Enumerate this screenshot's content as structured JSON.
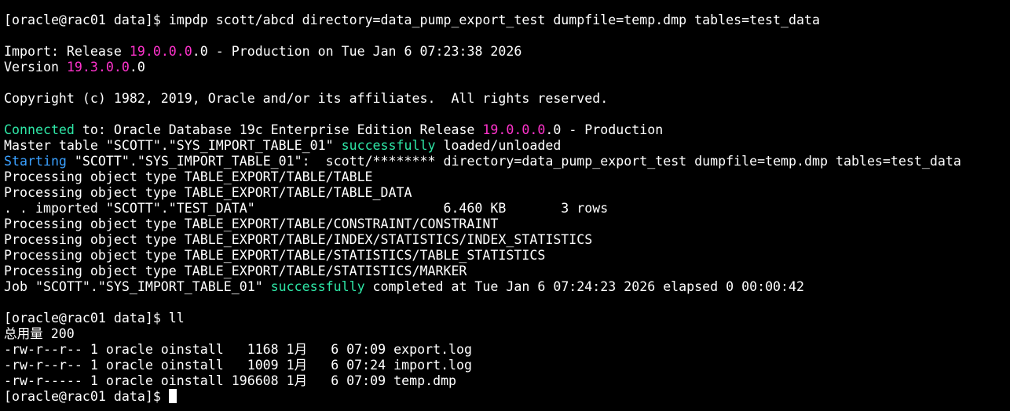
{
  "colors": {
    "background": "#000000",
    "foreground": "#ffffff",
    "magenta": "#ff33cc",
    "green": "#2ee6a6",
    "blue": "#3aa0ff",
    "cursor": "#ffffff"
  },
  "terminal": {
    "lines": [
      {
        "segments": [
          {
            "text": "[oracle@rac01 data]$ impdp scott/abcd directory=data_pump_export_test dumpfile=temp.dmp tables=test_data"
          }
        ]
      },
      {
        "segments": [
          {
            "text": ""
          }
        ]
      },
      {
        "segments": [
          {
            "text": "Import: Release "
          },
          {
            "text": "19.0.0.0",
            "color": "magenta"
          },
          {
            "text": ".0 - Production on Tue Jan 6 07:23:38 2026"
          }
        ]
      },
      {
        "segments": [
          {
            "text": "Version "
          },
          {
            "text": "19.3.0.0",
            "color": "magenta"
          },
          {
            "text": ".0"
          }
        ]
      },
      {
        "segments": [
          {
            "text": ""
          }
        ]
      },
      {
        "segments": [
          {
            "text": "Copyright (c) 1982, 2019, Oracle and/or its affiliates.  All rights reserved."
          }
        ]
      },
      {
        "segments": [
          {
            "text": ""
          }
        ]
      },
      {
        "segments": [
          {
            "text": "Connected",
            "color": "green"
          },
          {
            "text": " to: Oracle Database 19c Enterprise Edition Release "
          },
          {
            "text": "19.0.0.0",
            "color": "magenta"
          },
          {
            "text": ".0 - Production"
          }
        ]
      },
      {
        "segments": [
          {
            "text": "Master table \"SCOTT\".\"SYS_IMPORT_TABLE_01\" "
          },
          {
            "text": "successfully",
            "color": "green"
          },
          {
            "text": " loaded/unloaded"
          }
        ]
      },
      {
        "segments": [
          {
            "text": "Starting",
            "color": "blue"
          },
          {
            "text": " \"SCOTT\".\"SYS_IMPORT_TABLE_01\":  scott/******** directory=data_pump_export_test dumpfile=temp.dmp tables=test_data"
          }
        ]
      },
      {
        "segments": [
          {
            "text": "Processing object type TABLE_EXPORT/TABLE/TABLE"
          }
        ]
      },
      {
        "segments": [
          {
            "text": "Processing object type TABLE_EXPORT/TABLE/TABLE_DATA"
          }
        ]
      },
      {
        "segments": [
          {
            "text": ". . imported \"SCOTT\".\"TEST_DATA\"                        6.460 KB       3 rows"
          }
        ]
      },
      {
        "segments": [
          {
            "text": "Processing object type TABLE_EXPORT/TABLE/CONSTRAINT/CONSTRAINT"
          }
        ]
      },
      {
        "segments": [
          {
            "text": "Processing object type TABLE_EXPORT/TABLE/INDEX/STATISTICS/INDEX_STATISTICS"
          }
        ]
      },
      {
        "segments": [
          {
            "text": "Processing object type TABLE_EXPORT/TABLE/STATISTICS/TABLE_STATISTICS"
          }
        ]
      },
      {
        "segments": [
          {
            "text": "Processing object type TABLE_EXPORT/TABLE/STATISTICS/MARKER"
          }
        ]
      },
      {
        "segments": [
          {
            "text": "Job \"SCOTT\".\"SYS_IMPORT_TABLE_01\" "
          },
          {
            "text": "successfully",
            "color": "green"
          },
          {
            "text": " completed at Tue Jan 6 07:24:23 2026 elapsed 0 00:00:42"
          }
        ]
      },
      {
        "segments": [
          {
            "text": ""
          }
        ]
      },
      {
        "segments": [
          {
            "text": "[oracle@rac01 data]$ ll"
          }
        ]
      },
      {
        "segments": [
          {
            "text": "总用量 200"
          }
        ]
      },
      {
        "segments": [
          {
            "text": "-rw-r--r-- 1 oracle oinstall   1168 1月   6 07:09 export.log"
          }
        ]
      },
      {
        "segments": [
          {
            "text": "-rw-r--r-- 1 oracle oinstall   1009 1月   6 07:24 import.log"
          }
        ]
      },
      {
        "segments": [
          {
            "text": "-rw-r----- 1 oracle oinstall 196608 1月   6 07:09 temp.dmp"
          }
        ]
      },
      {
        "segments": [
          {
            "text": "[oracle@rac01 data]$ "
          }
        ],
        "cursor": true
      }
    ]
  }
}
